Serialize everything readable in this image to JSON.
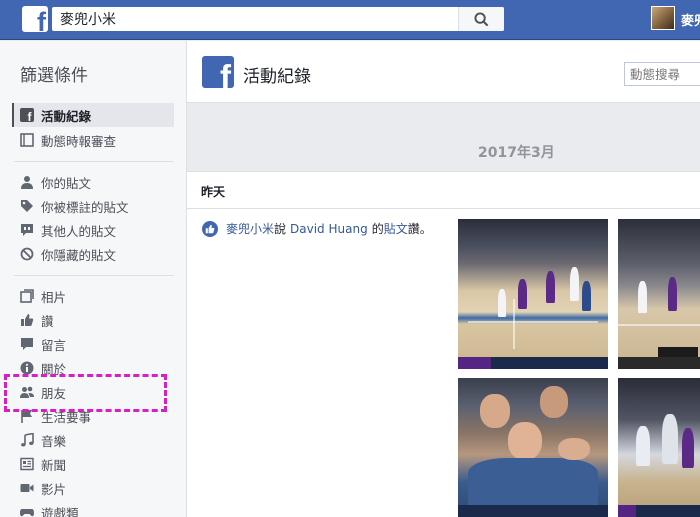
{
  "topbar": {
    "search_value": "麥兜小米",
    "user_name": "麥兜"
  },
  "sidebar": {
    "title": "篩選條件",
    "groups": [
      [
        {
          "label": "活動紀錄",
          "icon": "facebook-f-icon",
          "active": true
        },
        {
          "label": "動態時報審查",
          "icon": "timeline-review-icon"
        }
      ],
      [
        {
          "label": "你的貼文",
          "icon": "person-icon"
        },
        {
          "label": "你被標註的貼文",
          "icon": "tag-icon"
        },
        {
          "label": "其他人的貼文",
          "icon": "comment-quote-icon"
        },
        {
          "label": "你隱藏的貼文",
          "icon": "hidden-icon"
        }
      ],
      [
        {
          "label": "相片",
          "icon": "photos-icon"
        },
        {
          "label": "讚",
          "icon": "thumbs-up-icon"
        },
        {
          "label": "留言",
          "icon": "comment-icon"
        },
        {
          "label": "關於",
          "icon": "info-icon"
        },
        {
          "label": "朋友",
          "icon": "friends-icon"
        },
        {
          "label": "生活要事",
          "icon": "flag-icon"
        },
        {
          "label": "音樂",
          "icon": "music-icon"
        },
        {
          "label": "新聞",
          "icon": "news-icon"
        },
        {
          "label": "影片",
          "icon": "video-icon"
        },
        {
          "label": "遊戲類",
          "icon": "game-icon"
        }
      ]
    ]
  },
  "main": {
    "title": "活動紀錄",
    "search_placeholder": "動態搜尋",
    "month": "2017年3月",
    "section": "昨天",
    "activity": {
      "actor": "麥兜小米",
      "verb1": "說",
      "target": "David Huang",
      "connector": "的",
      "object": "貼文",
      "end": "讚。"
    }
  },
  "colors": {
    "brand": "#4267b2",
    "link": "#365899",
    "highlight": "#d61fc4"
  }
}
